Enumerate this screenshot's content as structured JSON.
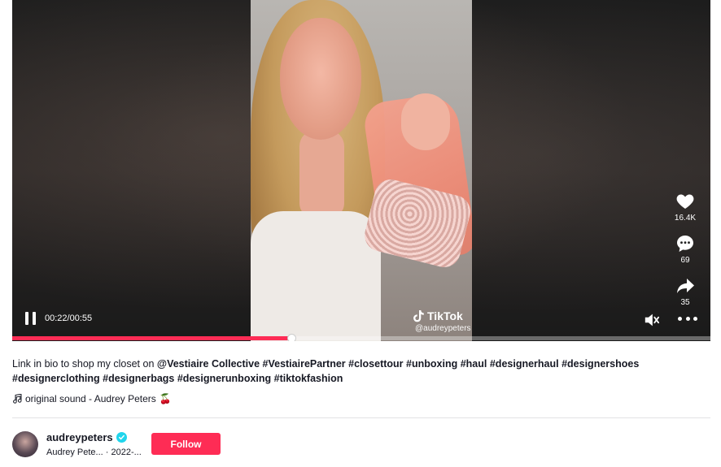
{
  "player": {
    "time": "00:22/00:55",
    "progress": 0.4,
    "watermark_brand": "TikTok",
    "watermark_handle": "@audreypeters",
    "likes": "16.4K",
    "comments": "69",
    "shares": "35",
    "icons": {
      "like": "heart-icon",
      "comment": "comment-icon",
      "share": "share-icon",
      "mute": "muted-speaker-icon",
      "more": "more-dots-icon",
      "pause": "pause-icon"
    }
  },
  "caption": {
    "text": "Link in bio to shop my closet on ",
    "mention": "@Vestiaire Collective",
    "hashtags": [
      "#VestiairePartner",
      "#closettour",
      "#unboxing",
      "#haul",
      "#designerhaul",
      "#designershoes",
      "#designerclothing",
      "#designerbags",
      "#designerunboxing",
      "#tiktokfashion"
    ]
  },
  "sound": {
    "label": "original sound - Audrey Peters",
    "emoji": "🍒"
  },
  "author": {
    "username": "audreypeters",
    "subline": "Audrey Pete... · 2022-...",
    "follow_label": "Follow"
  },
  "colors": {
    "accent": "#fe2c55",
    "verified": "#20d5ec"
  }
}
